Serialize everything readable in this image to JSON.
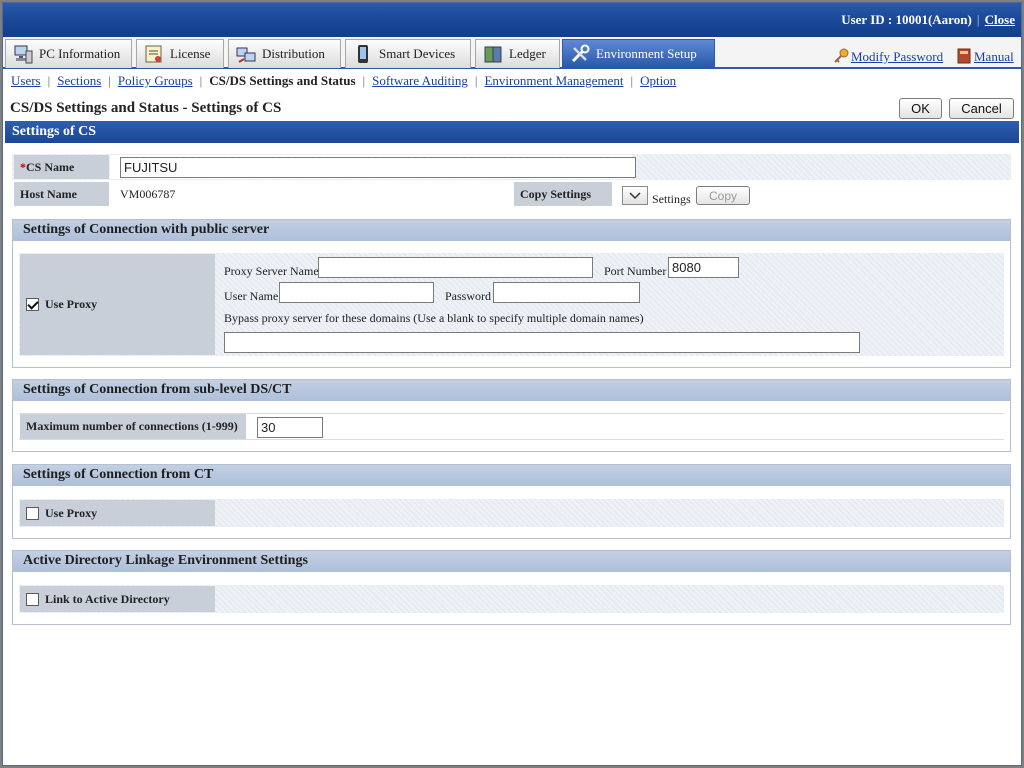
{
  "user": {
    "label": "User ID : 10001(Aaron)",
    "close": "Close"
  },
  "tabs": [
    {
      "label": "PC Information",
      "icon": "pc-icon"
    },
    {
      "label": "License",
      "icon": "license-icon"
    },
    {
      "label": "Distribution",
      "icon": "distribution-icon"
    },
    {
      "label": "Smart Devices",
      "icon": "smart-device-icon"
    },
    {
      "label": "Ledger",
      "icon": "ledger-icon"
    },
    {
      "label": "Environment Setup",
      "icon": "tools-icon"
    }
  ],
  "links": {
    "modify_password": "Modify Password",
    "manual": "Manual"
  },
  "subnav": {
    "users": "Users",
    "sections": "Sections",
    "policy_groups": "Policy Groups",
    "current": "CS/DS Settings and Status",
    "software_auditing": "Software Auditing",
    "env_mgmt": "Environment Management",
    "option": "Option"
  },
  "page": {
    "title": "CS/DS Settings and Status - Settings of CS",
    "ok": "OK",
    "cancel": "Cancel"
  },
  "settings": {
    "header": "Settings of CS",
    "cs_name_required": "*",
    "cs_name_label": "CS Name",
    "cs_name_value": "FUJITSU",
    "host_name_label": "Host Name",
    "host_name_value": "VM006787",
    "copy_settings_label": "Copy Settings",
    "copy_settings_suffix": "Settings",
    "copy_button": "Copy"
  },
  "public_server": {
    "header": "Settings of Connection with public server",
    "use_proxy": "Use Proxy",
    "use_proxy_checked": true,
    "proxy_server_label": "Proxy Server Name",
    "proxy_server_value": "",
    "port_label": "Port Number",
    "port_value": "8080",
    "user_label": "User Name",
    "user_value": "",
    "password_label": "Password",
    "password_value": "",
    "bypass_label": "Bypass proxy server for these domains (Use a blank to specify multiple domain names)",
    "bypass_value": ""
  },
  "sublevel": {
    "header": "Settings of Connection from sub-level DS/CT",
    "max_conn_label": "Maximum number of connections (1-999)",
    "max_conn_value": "30"
  },
  "ct": {
    "header": "Settings of Connection from CT",
    "use_proxy": "Use Proxy",
    "use_proxy_checked": false
  },
  "ad": {
    "header": "Active Directory Linkage Environment Settings",
    "link": "Link to Active Directory",
    "link_checked": false
  }
}
